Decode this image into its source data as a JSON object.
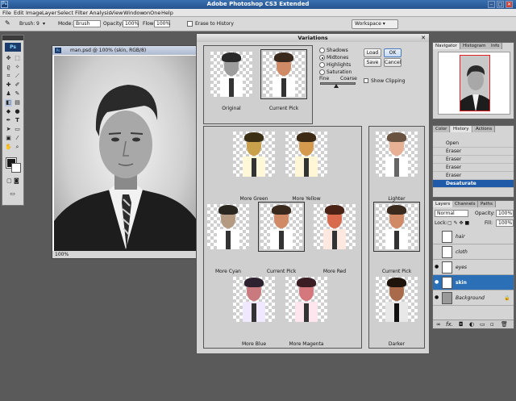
{
  "app": {
    "title": "Adobe Photoshop CS3 Extended",
    "logo": "Ps"
  },
  "window_controls": {
    "minimize": "–",
    "maximize": "□",
    "close": "✕"
  },
  "menu": [
    "File",
    "Edit",
    "Image",
    "Layer",
    "Select",
    "Filter",
    "Analysis",
    "View",
    "Window",
    "onOne",
    "Help"
  ],
  "options": {
    "brush_label": "Brush:",
    "brush_size": "9",
    "mode_label": "Mode:",
    "mode_value": "Brush",
    "opacity_label": "Opacity:",
    "opacity_value": "100%",
    "flow_label": "Flow:",
    "flow_value": "100%",
    "erase_history": "Erase to History",
    "workspace": "Workspace ▾"
  },
  "toolbox": {
    "badge": "Ps"
  },
  "document": {
    "title": "man.psd @ 100% (skin, RGB/8)",
    "zoom": "100%"
  },
  "variations": {
    "title": "Variations",
    "original": "Original",
    "current_pick": "Current Pick",
    "radios": [
      "Shadows",
      "Midtones",
      "Highlights",
      "Saturation"
    ],
    "selected_radio": "Midtones",
    "fine": "Fine",
    "coarse": "Coarse",
    "show_clipping": "Show Clipping",
    "buttons": {
      "load": "Load",
      "ok": "OK",
      "save": "Save",
      "cancel": "Cancel"
    },
    "more_green": "More Green",
    "more_yellow": "More Yellow",
    "more_cyan": "More Cyan",
    "more_red": "More Red",
    "more_blue": "More Blue",
    "more_magenta": "More Magenta",
    "lighter": "Lighter",
    "darker": "Darker"
  },
  "navigator": {
    "tabs": [
      "Navigator",
      "Histogram",
      "Info"
    ]
  },
  "history": {
    "tabs": [
      "Color",
      "History",
      "Actions"
    ],
    "items": [
      "Open",
      "Eraser",
      "Eraser",
      "Eraser",
      "Eraser",
      "Desaturate"
    ],
    "selected_index": 5
  },
  "layers": {
    "tabs": [
      "Layers",
      "Channels",
      "Paths"
    ],
    "blend": "Normal",
    "opacity_label": "Opacity:",
    "opacity": "100%",
    "lock_label": "Lock:",
    "fill_label": "Fill:",
    "fill": "100%",
    "items": [
      "hair",
      "cloth",
      "eyes",
      "skin",
      "Background"
    ],
    "selected": "skin",
    "footer_icons": [
      "link-icon",
      "fx-icon",
      "mask-icon",
      "adjustment-icon",
      "group-icon",
      "new-layer-icon",
      "trash-icon"
    ]
  },
  "colors": {
    "accent": "#2b6fb6",
    "titlebar": "#24548f"
  }
}
